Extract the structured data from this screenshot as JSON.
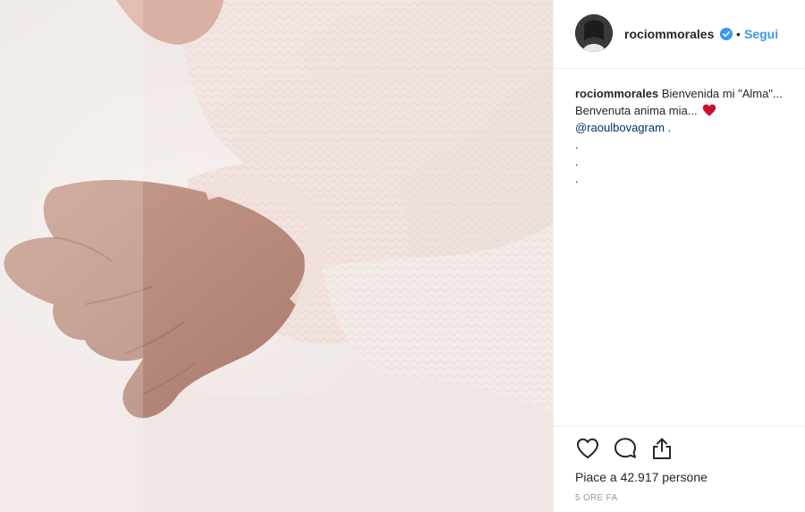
{
  "post": {
    "username": "rociommorales",
    "follow_label": "Segui",
    "separator": "•",
    "caption": {
      "user": "rociommorales",
      "line1": "Bienvenida mi \"Alma\"...",
      "line2": "Benvenuta anima mia...",
      "mention": "@raoulbovagram",
      "mention_suffix": " .",
      "dots": [
        ".",
        ".",
        "."
      ]
    },
    "likes_text": "Piace a 42.917 persone",
    "timestamp": "5 ORE FA"
  },
  "icons": {
    "verified": "verified-badge-icon",
    "like": "heart-outline-icon",
    "comment": "comment-bubble-icon",
    "share": "share-icon",
    "caption_emoji": "red-heart-emoji"
  },
  "colors": {
    "accent": "#3897f0",
    "verified": "#3897f0",
    "mention": "#003569",
    "text": "#262626",
    "muted": "#999999",
    "heart": "#c8102e"
  }
}
